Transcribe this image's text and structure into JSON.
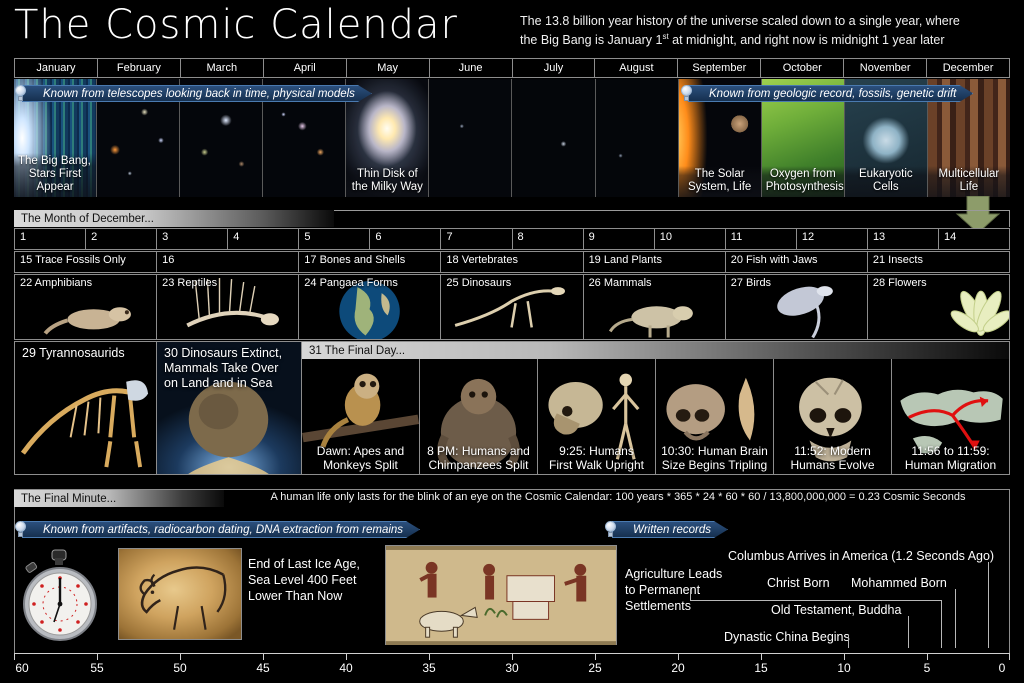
{
  "title": "The Cosmic Calendar",
  "subtitle_line1": "The 13.8 billion year history of the universe scaled down to a single year, where",
  "subtitle_line2_a": "the Big Bang is January 1",
  "subtitle_line2_sup": "st",
  "subtitle_line2_b": " at midnight, and right now is midnight 1 year later",
  "months": [
    {
      "label": "January"
    },
    {
      "label": "February"
    },
    {
      "label": "March"
    },
    {
      "label": "April"
    },
    {
      "label": "May"
    },
    {
      "label": "June"
    },
    {
      "label": "July"
    },
    {
      "label": "August"
    },
    {
      "label": "September"
    },
    {
      "label": "October"
    },
    {
      "label": "November"
    },
    {
      "label": "December"
    }
  ],
  "year_band": {
    "banner_left": "Known from telescopes looking back in time, physical models",
    "banner_right": "Known from geologic record, fossils, genetic drift",
    "captions": {
      "big_bang_l1": "The Big Bang,",
      "big_bang_l2": "Stars First Appear",
      "milky_l1": "Thin Disk of",
      "milky_l2": "the Milky Way",
      "solar_l1": "The Solar",
      "solar_l2": "System, Life",
      "oxygen_l1": "Oxygen from",
      "oxygen_l2": "Photosynthesis",
      "euk_l1": "Eukaryotic",
      "euk_l2": "Cells",
      "multi_l1": "Multicellular",
      "multi_l2": "Life"
    }
  },
  "december": {
    "header": "The Month of December...",
    "days_1_14": [
      "1",
      "2",
      "3",
      "4",
      "5",
      "6",
      "7",
      "8",
      "9",
      "10",
      "11",
      "12",
      "13",
      "14"
    ],
    "days_15_21": [
      "15 Trace Fossils Only",
      "16",
      "17 Bones and Shells",
      "18 Vertebrates",
      "19 Land Plants",
      "20 Fish with Jaws",
      "21 Insects"
    ],
    "days_22_28": [
      "22 Amphibians",
      "23 Reptiles",
      "24 Pangaea Forms",
      "25 Dinosaurs",
      "26 Mammals",
      "27 Birds",
      "28 Flowers"
    ],
    "day_29": "29 Tyrannosaurids",
    "day_30_l1": "30 Dinosaurs Extinct,",
    "day_30_l2": "Mammals Take Over",
    "day_30_l3": "on Land and in Sea",
    "day_31_header": "31 The Final Day...",
    "final_day_events": [
      {
        "l1": "Dawn: Apes and",
        "l2": "Monkeys Split"
      },
      {
        "l1": "8 PM: Humans and",
        "l2": "Chimpanzees Split"
      },
      {
        "l1": "9:25: Humans",
        "l2": "First Walk Upright"
      },
      {
        "l1": "10:30: Human Brain",
        "l2": "Size Begins Tripling"
      },
      {
        "l1": "11:52: Modern",
        "l2": "Humans Evolve"
      },
      {
        "l1": "11:56 to 11:59:",
        "l2": "Human Migration"
      }
    ]
  },
  "final_minute": {
    "header": "The Final Minute...",
    "note": "A human life only lasts for the blink of an eye on the Cosmic Calendar: 100 years * 365 * 24 * 60 * 60  / 13,800,000,000 = 0.23 Cosmic Seconds",
    "banner_left": "Known from artifacts, radiocarbon dating, DNA extraction from remains",
    "banner_right": "Written records",
    "ice_age_l1": "End of Last Ice Age,",
    "ice_age_l2": "Sea Level 400 Feet",
    "ice_age_l3": "Lower Than Now",
    "agriculture_l1": "Agriculture Leads",
    "agriculture_l2": "to Permanent",
    "agriculture_l3": "Settlements",
    "annotations": [
      {
        "label": "Columbus Arrives in America (1.2 Seconds Ago)",
        "seconds": 1.2
      },
      {
        "label": "Christ Born",
        "seconds": 4.6
      },
      {
        "label": "Mohammed Born",
        "seconds": 2.9
      },
      {
        "label": "Old Testament, Buddha",
        "seconds": 6.2
      },
      {
        "label": "Dynastic China Begins",
        "seconds": 8.5
      }
    ],
    "axis": {
      "ticks": [
        "60",
        "55",
        "50",
        "45",
        "40",
        "35",
        "30",
        "25",
        "20",
        "15",
        "10",
        "5",
        "0"
      ],
      "min": 0,
      "max": 60,
      "unit": "cosmic seconds"
    }
  },
  "colors": {
    "background": "#000000",
    "banner_blue": "#2b4f7d",
    "banner_border": "#4a7ab0",
    "grid_line": "#8d8d8d",
    "green_arrow": "#8d9c6a",
    "text": "#ffffff"
  },
  "icons": {
    "lightbulb": "lightbulb-icon",
    "arrow_down": "arrow-down-icon",
    "stopwatch": "stopwatch-icon"
  }
}
